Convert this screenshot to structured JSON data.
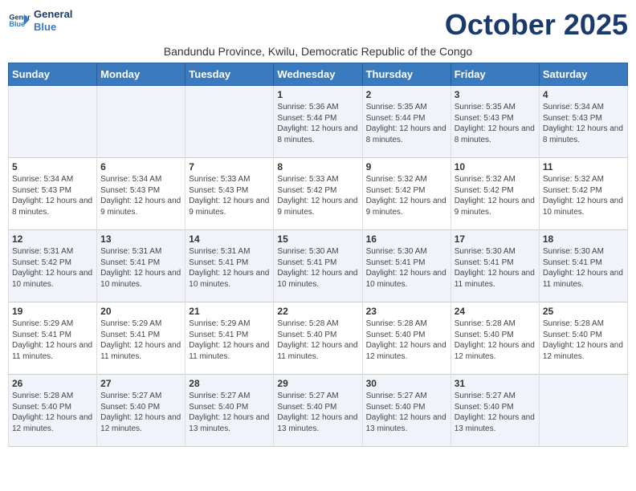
{
  "header": {
    "logo_line1": "General",
    "logo_line2": "Blue",
    "month_title": "October 2025",
    "subtitle": "Bandundu Province, Kwilu, Democratic Republic of the Congo"
  },
  "days_of_week": [
    "Sunday",
    "Monday",
    "Tuesday",
    "Wednesday",
    "Thursday",
    "Friday",
    "Saturday"
  ],
  "weeks": [
    {
      "days": [
        {
          "date": "",
          "content": ""
        },
        {
          "date": "",
          "content": ""
        },
        {
          "date": "",
          "content": ""
        },
        {
          "date": "1",
          "content": "Sunrise: 5:36 AM\nSunset: 5:44 PM\nDaylight: 12 hours and 8 minutes."
        },
        {
          "date": "2",
          "content": "Sunrise: 5:35 AM\nSunset: 5:44 PM\nDaylight: 12 hours and 8 minutes."
        },
        {
          "date": "3",
          "content": "Sunrise: 5:35 AM\nSunset: 5:43 PM\nDaylight: 12 hours and 8 minutes."
        },
        {
          "date": "4",
          "content": "Sunrise: 5:34 AM\nSunset: 5:43 PM\nDaylight: 12 hours and 8 minutes."
        }
      ]
    },
    {
      "days": [
        {
          "date": "5",
          "content": "Sunrise: 5:34 AM\nSunset: 5:43 PM\nDaylight: 12 hours and 8 minutes."
        },
        {
          "date": "6",
          "content": "Sunrise: 5:34 AM\nSunset: 5:43 PM\nDaylight: 12 hours and 9 minutes."
        },
        {
          "date": "7",
          "content": "Sunrise: 5:33 AM\nSunset: 5:43 PM\nDaylight: 12 hours and 9 minutes."
        },
        {
          "date": "8",
          "content": "Sunrise: 5:33 AM\nSunset: 5:42 PM\nDaylight: 12 hours and 9 minutes."
        },
        {
          "date": "9",
          "content": "Sunrise: 5:32 AM\nSunset: 5:42 PM\nDaylight: 12 hours and 9 minutes."
        },
        {
          "date": "10",
          "content": "Sunrise: 5:32 AM\nSunset: 5:42 PM\nDaylight: 12 hours and 9 minutes."
        },
        {
          "date": "11",
          "content": "Sunrise: 5:32 AM\nSunset: 5:42 PM\nDaylight: 12 hours and 10 minutes."
        }
      ]
    },
    {
      "days": [
        {
          "date": "12",
          "content": "Sunrise: 5:31 AM\nSunset: 5:42 PM\nDaylight: 12 hours and 10 minutes."
        },
        {
          "date": "13",
          "content": "Sunrise: 5:31 AM\nSunset: 5:41 PM\nDaylight: 12 hours and 10 minutes."
        },
        {
          "date": "14",
          "content": "Sunrise: 5:31 AM\nSunset: 5:41 PM\nDaylight: 12 hours and 10 minutes."
        },
        {
          "date": "15",
          "content": "Sunrise: 5:30 AM\nSunset: 5:41 PM\nDaylight: 12 hours and 10 minutes."
        },
        {
          "date": "16",
          "content": "Sunrise: 5:30 AM\nSunset: 5:41 PM\nDaylight: 12 hours and 10 minutes."
        },
        {
          "date": "17",
          "content": "Sunrise: 5:30 AM\nSunset: 5:41 PM\nDaylight: 12 hours and 11 minutes."
        },
        {
          "date": "18",
          "content": "Sunrise: 5:30 AM\nSunset: 5:41 PM\nDaylight: 12 hours and 11 minutes."
        }
      ]
    },
    {
      "days": [
        {
          "date": "19",
          "content": "Sunrise: 5:29 AM\nSunset: 5:41 PM\nDaylight: 12 hours and 11 minutes."
        },
        {
          "date": "20",
          "content": "Sunrise: 5:29 AM\nSunset: 5:41 PM\nDaylight: 12 hours and 11 minutes."
        },
        {
          "date": "21",
          "content": "Sunrise: 5:29 AM\nSunset: 5:41 PM\nDaylight: 12 hours and 11 minutes."
        },
        {
          "date": "22",
          "content": "Sunrise: 5:28 AM\nSunset: 5:40 PM\nDaylight: 12 hours and 11 minutes."
        },
        {
          "date": "23",
          "content": "Sunrise: 5:28 AM\nSunset: 5:40 PM\nDaylight: 12 hours and 12 minutes."
        },
        {
          "date": "24",
          "content": "Sunrise: 5:28 AM\nSunset: 5:40 PM\nDaylight: 12 hours and 12 minutes."
        },
        {
          "date": "25",
          "content": "Sunrise: 5:28 AM\nSunset: 5:40 PM\nDaylight: 12 hours and 12 minutes."
        }
      ]
    },
    {
      "days": [
        {
          "date": "26",
          "content": "Sunrise: 5:28 AM\nSunset: 5:40 PM\nDaylight: 12 hours and 12 minutes."
        },
        {
          "date": "27",
          "content": "Sunrise: 5:27 AM\nSunset: 5:40 PM\nDaylight: 12 hours and 12 minutes."
        },
        {
          "date": "28",
          "content": "Sunrise: 5:27 AM\nSunset: 5:40 PM\nDaylight: 12 hours and 13 minutes."
        },
        {
          "date": "29",
          "content": "Sunrise: 5:27 AM\nSunset: 5:40 PM\nDaylight: 12 hours and 13 minutes."
        },
        {
          "date": "30",
          "content": "Sunrise: 5:27 AM\nSunset: 5:40 PM\nDaylight: 12 hours and 13 minutes."
        },
        {
          "date": "31",
          "content": "Sunrise: 5:27 AM\nSunset: 5:40 PM\nDaylight: 12 hours and 13 minutes."
        },
        {
          "date": "",
          "content": ""
        }
      ]
    }
  ]
}
